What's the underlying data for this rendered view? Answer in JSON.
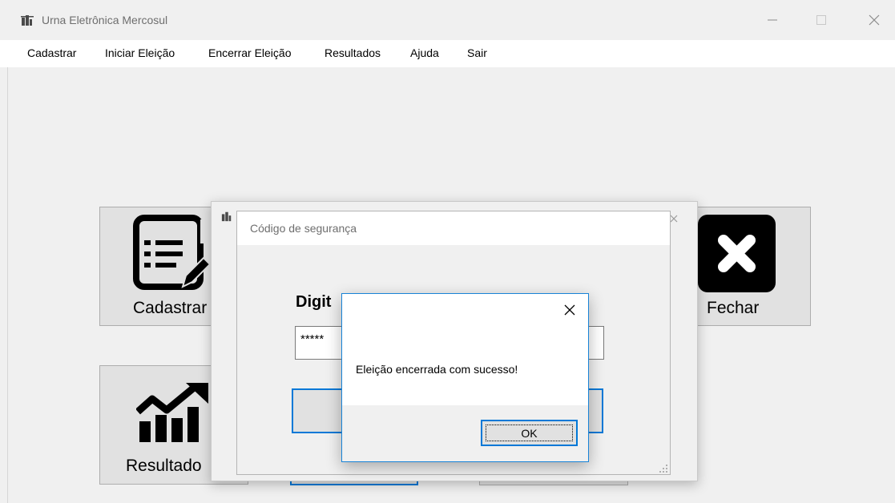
{
  "window": {
    "title": "Urna Eletrônica Mercosul",
    "controls": [
      "minimize",
      "maximize",
      "close"
    ]
  },
  "menu": {
    "items": [
      "Cadastrar",
      "Iniciar Eleição",
      "Encerrar Eleição",
      "Resultados",
      "Ajuda",
      "Sair"
    ]
  },
  "tiles": {
    "cadastrar": {
      "label": "Cadastrar",
      "icon": "form-edit-icon"
    },
    "fechar": {
      "label": "Fechar",
      "icon": "close-x-icon"
    },
    "resultados": {
      "label": "Resultado",
      "icon": "chart-trend-icon"
    }
  },
  "security_dialog": {
    "title": "Código de segurança",
    "prompt": "Digit",
    "input_value": "*****"
  },
  "message_box": {
    "text": "Eleição encerrada com sucesso!",
    "ok_label": "OK"
  },
  "colors": {
    "accent": "#0078d7",
    "window_bg": "#f0f0f0",
    "tile_bg": "#e1e1e1"
  }
}
